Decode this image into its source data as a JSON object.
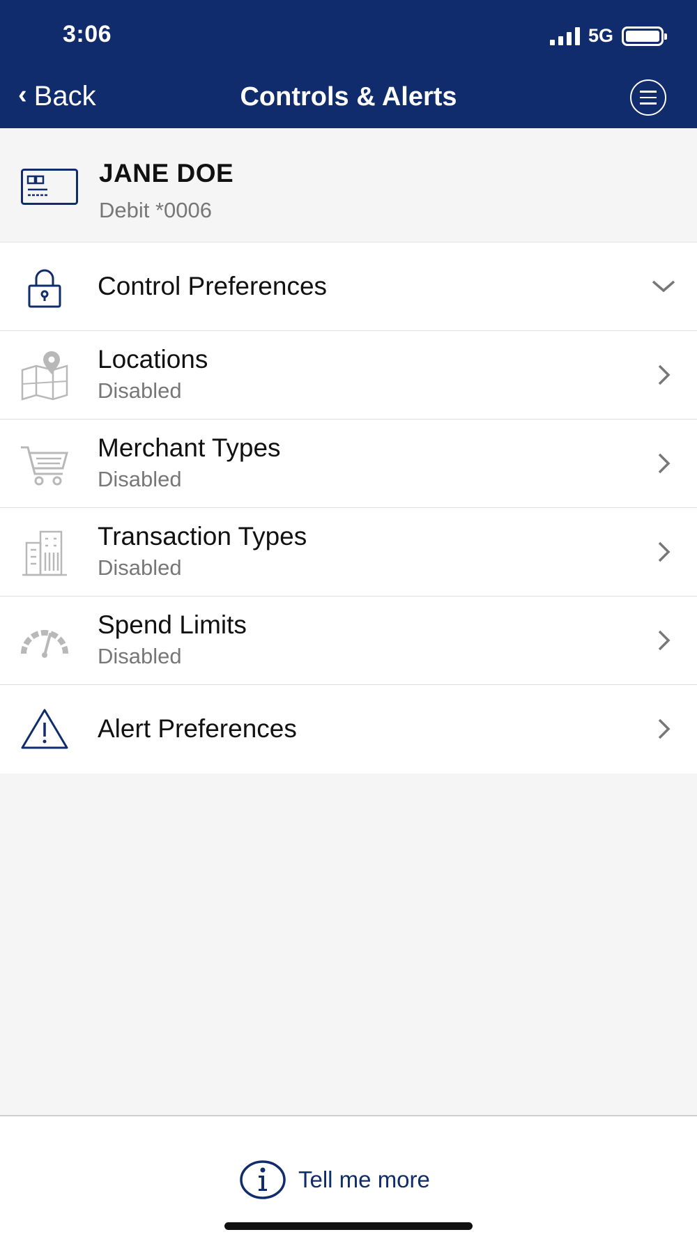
{
  "status_bar": {
    "time": "3:06",
    "network": "5G"
  },
  "header": {
    "back_label": "Back",
    "title": "Controls & Alerts"
  },
  "account": {
    "name": "JANE DOE",
    "card": "Debit *0006"
  },
  "list": {
    "control_preferences": "Control Preferences",
    "items": [
      {
        "label": "Locations",
        "status": "Disabled",
        "icon": "map-pin-icon"
      },
      {
        "label": "Merchant Types",
        "status": "Disabled",
        "icon": "shopping-cart-icon"
      },
      {
        "label": "Transaction Types",
        "status": "Disabled",
        "icon": "building-icon"
      },
      {
        "label": "Spend Limits",
        "status": "Disabled",
        "icon": "gauge-icon"
      }
    ],
    "alert_preferences": "Alert Preferences"
  },
  "footer": {
    "tell_more": "Tell me more"
  },
  "colors": {
    "brand": "#112c6c",
    "muted_icon": "#b8b8b8",
    "sub_text": "#777777"
  }
}
